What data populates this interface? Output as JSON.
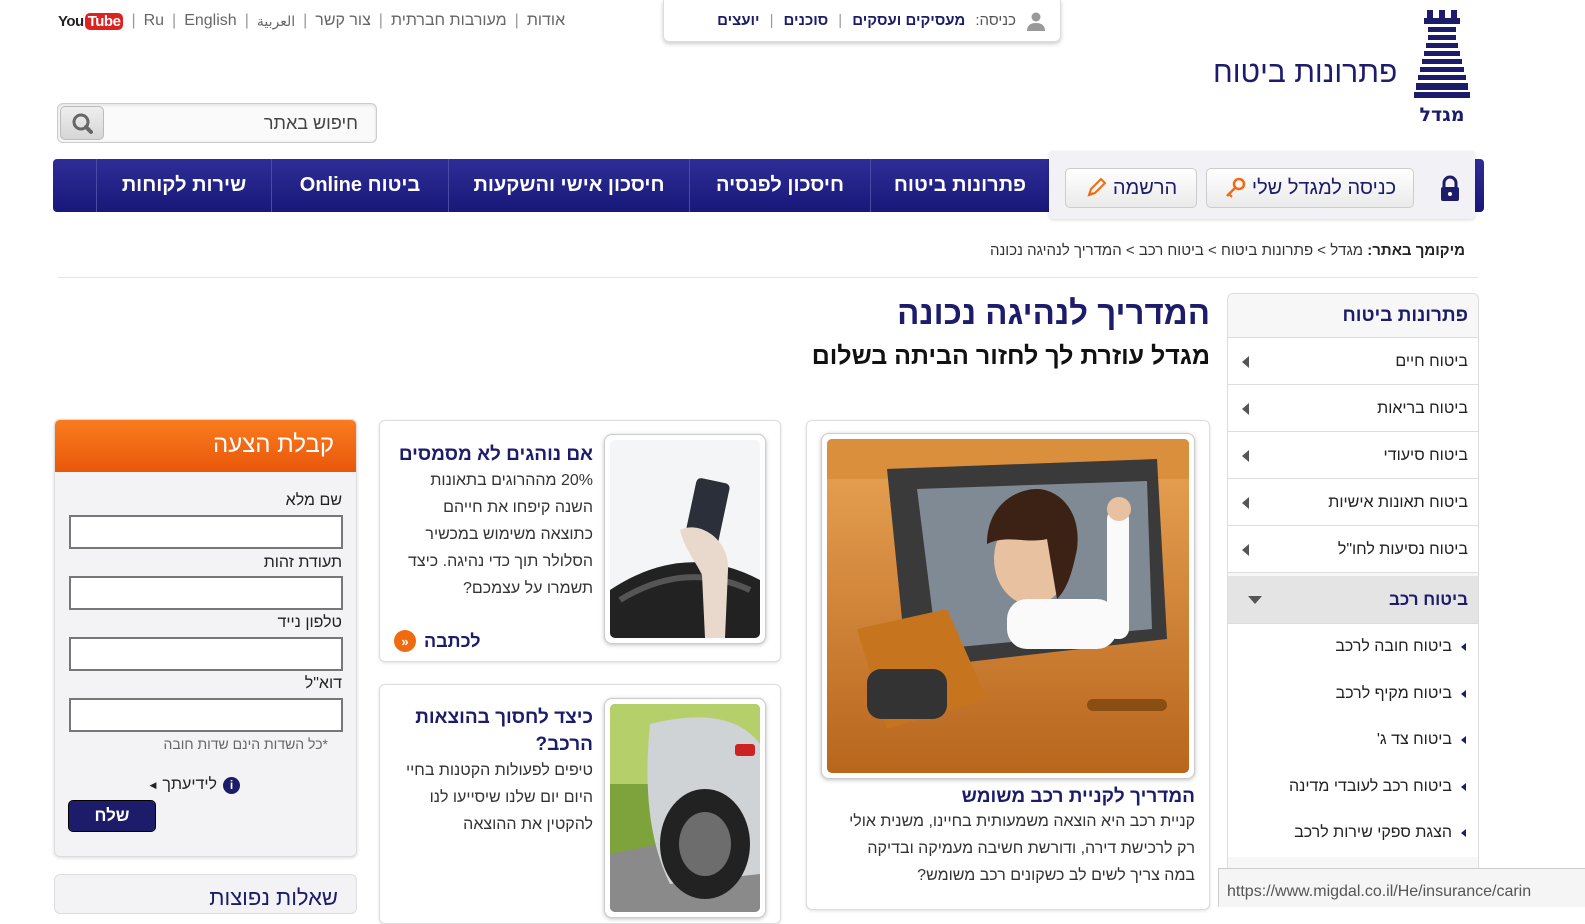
{
  "top_links": {
    "youtube_you": "You",
    "youtube_tube": "Tube",
    "ru": "Ru",
    "english": "English",
    "arabic": "العربية",
    "contact": "צור קשר",
    "social": "מעורבות חברתית",
    "about": "אודות"
  },
  "login_box": {
    "label": "כניסה:",
    "business": "מעסיקים ועסקים",
    "agents": "סוכנים",
    "advisors": "יועצים"
  },
  "brand": {
    "title": "פתרונות ביטוח",
    "logo_text": "מגדל"
  },
  "search": {
    "placeholder": "חיפוש באתר"
  },
  "nav": {
    "items": [
      "פתרונות ביטוח",
      "חיסכון לפנסיה",
      "חיסכון אישי והשקעות",
      "ביטוח Online",
      "שירות לקוחות"
    ],
    "login_button": "כניסה למגדל שלי",
    "register_button": "הרשמה"
  },
  "breadcrumb": {
    "label": "מיקומך באתר:",
    "items": [
      "מגדל",
      "פתרונות ביטוח",
      "ביטוח רכב",
      "המדריך לנהיגה נכונה"
    ],
    "separator": ">"
  },
  "page": {
    "title": "המדריך לנהיגה נכונה",
    "subtitle": "מגדל עוזרת לך לחזור הביתה בשלום"
  },
  "sidebar": {
    "header": "פתרונות ביטוח",
    "items": [
      "ביטוח חיים",
      "ביטוח בריאות",
      "ביטוח סיעודי",
      "ביטוח תאונות אישיות",
      "ביטוח נסיעות לחו\"ל"
    ],
    "active": "ביטוח רכב",
    "subitems": [
      "ביטוח חובה לרכב",
      "ביטוח מקיף לרכב",
      "ביטוח צד ג'",
      "ביטוח רכב לעובדי מדינה",
      "הצגת ספקי שירות לרכב"
    ]
  },
  "cards": {
    "main": {
      "title": "המדריך לקניית רכב משומש",
      "body": [
        "קניית רכב היא הוצאה משמעותית בחיינו, משנית אולי",
        "רק לרכישת דירה, ודורשת חשיבה מעמיקה ובדיקה",
        "במה צריך לשים לב כשקונים רכב משומש?"
      ]
    },
    "texting": {
      "title": "אם נוהגים לא מסמסים",
      "body": [
        "20% מההרוגים בתאונות",
        "השנה קיפחו את חייהם",
        "כתוצאה משימוש במכשיר",
        "הסלולר תוך כדי נהיגה. כיצד",
        "תשמרו על עצמכם?"
      ],
      "more": "לכתבה"
    },
    "saving": {
      "title": [
        "כיצד לחסוך בהוצאות",
        "הרכב?"
      ],
      "body": [
        "טיפים לפעולות הקטנות בחיי",
        "היום יום שלנו שיסייעו לנו",
        "להקטין את ההוצאה"
      ]
    }
  },
  "form": {
    "header": "קבלת הצעה",
    "fields": [
      "שם מלא",
      "תעודת זהות",
      "טלפון נייד",
      "דוא\"ל"
    ],
    "note": "*כל השדות הינם שדות חובה",
    "info": "לידיעתך",
    "submit": "שלח"
  },
  "form2": {
    "header": "שאלות נפוצות"
  },
  "status_url": "https://www.migdal.co.il/He/insurance/carin"
}
